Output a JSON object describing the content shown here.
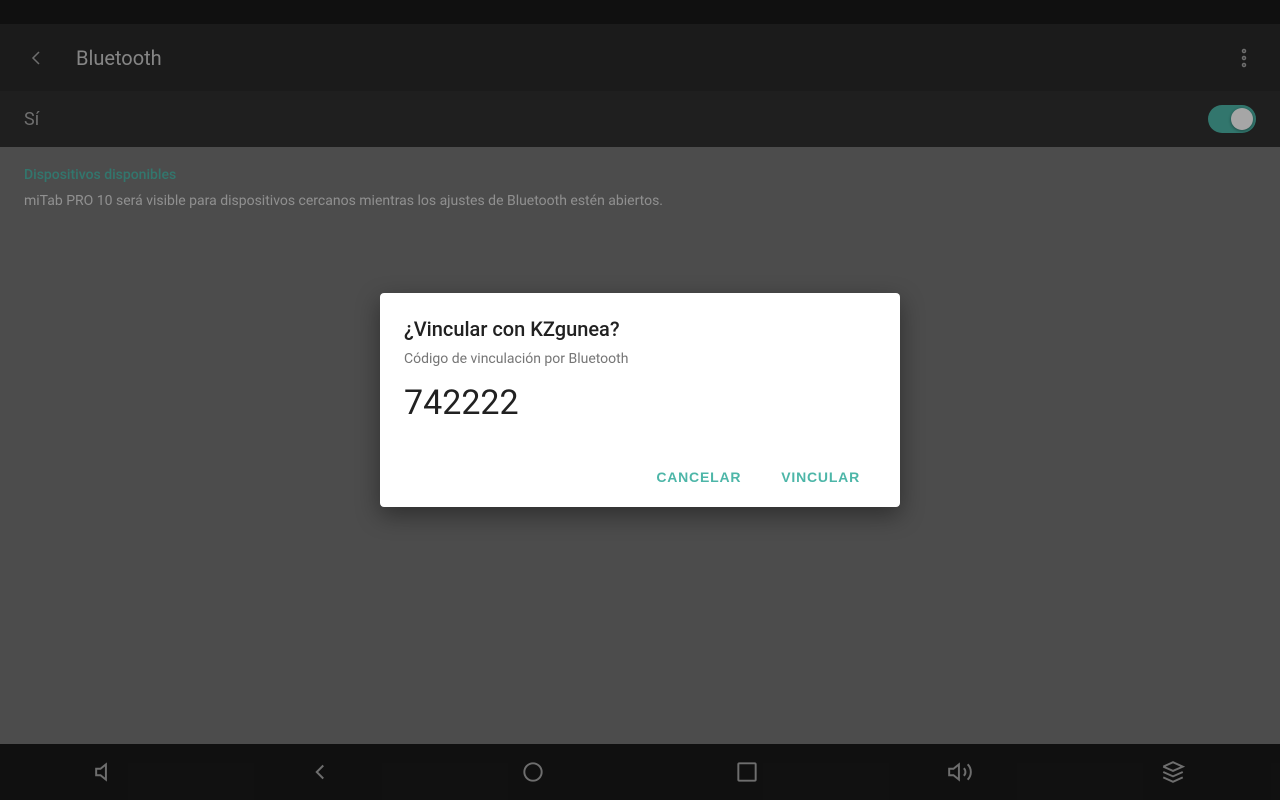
{
  "statusBar": {},
  "toolbar": {
    "title": "Bluetooth",
    "backIconLabel": "back",
    "menuIconLabel": "more-options"
  },
  "toggleRow": {
    "label": "Sí",
    "isOn": true
  },
  "content": {
    "sectionTitle": "Dispositivos disponibles",
    "sectionDesc": "miTab PRO 10 será visible para dispositivos cercanos mientras los ajustes de Bluetooth estén abiertos."
  },
  "dialog": {
    "title": "¿Vincular con KZgunea?",
    "subtitle": "Código de vinculación por Bluetooth",
    "code": "742222",
    "cancelLabel": "CANCELAR",
    "linkLabel": "VINCULAR"
  },
  "navBar": {
    "icons": [
      {
        "name": "volume-down-icon",
        "label": "volume down"
      },
      {
        "name": "back-icon",
        "label": "back"
      },
      {
        "name": "home-icon",
        "label": "home"
      },
      {
        "name": "recents-icon",
        "label": "recents"
      },
      {
        "name": "volume-up-icon",
        "label": "volume up"
      },
      {
        "name": "menu-icon",
        "label": "menu"
      }
    ]
  }
}
